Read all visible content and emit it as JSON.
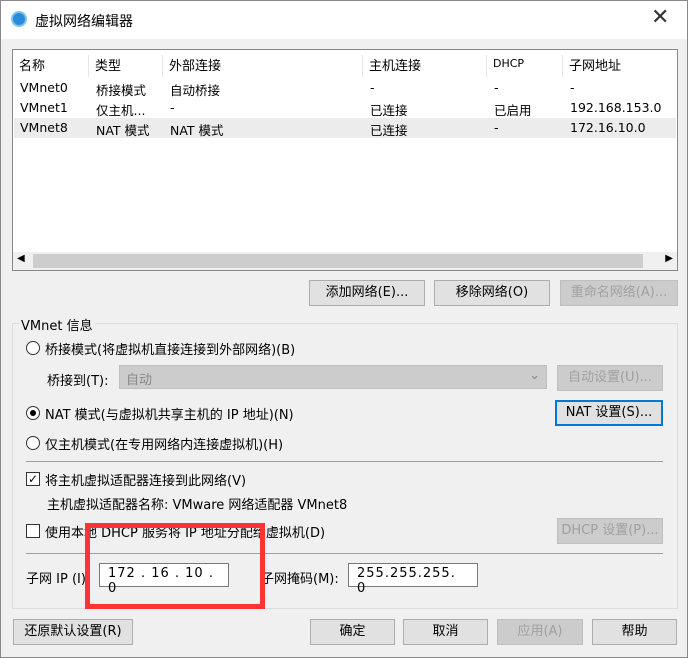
{
  "window": {
    "title": "虚拟网络编辑器"
  },
  "table": {
    "headers": [
      "名称",
      "类型",
      "外部连接",
      "主机连接",
      "DHCP",
      "子网地址"
    ],
    "rows": [
      [
        "VMnet0",
        "桥接模式",
        "自动桥接",
        "-",
        "-",
        "-"
      ],
      [
        "VMnet1",
        "仅主机...",
        "-",
        "已连接",
        "已启用",
        "192.168.153.0"
      ],
      [
        "VMnet8",
        "NAT 模式",
        "NAT 模式",
        "已连接",
        "-",
        "172.16.10.0"
      ]
    ]
  },
  "buttons": {
    "add": "添加网络(E)...",
    "remove": "移除网络(O)",
    "rename": "重命名网络(A)...",
    "auto": "自动设置(U)...",
    "nat": "NAT 设置(S)...",
    "dhcp": "DHCP 设置(P)...",
    "restore": "还原默认设置(R)",
    "ok": "确定",
    "cancel": "取消",
    "apply": "应用(A)",
    "help": "帮助"
  },
  "info": {
    "group_label": "VMnet 信息",
    "bridge": "桥接模式(将虚拟机直接连接到外部网络)(B)",
    "bridge_to": "桥接到(T):",
    "bridge_value": "自动",
    "nat": "NAT 模式(与虚拟机共享主机的 IP 地址)(N)",
    "hostonly": "仅主机模式(在专用网络内连接虚拟机)(H)",
    "connect_adapter": "将主机虚拟适配器连接到此网络(V)",
    "adapter_name": "主机虚拟适配器名称: VMware 网络适配器 VMnet8",
    "use_dhcp": "使用本地 DHCP 服务将 IP 地址分配给虚拟机(D)",
    "subnet_ip_label": "子网 IP (I):",
    "subnet_ip": "172 . 16 . 10 . 0",
    "mask_label": "子网掩码(M):",
    "mask": "255.255.255. 0"
  }
}
